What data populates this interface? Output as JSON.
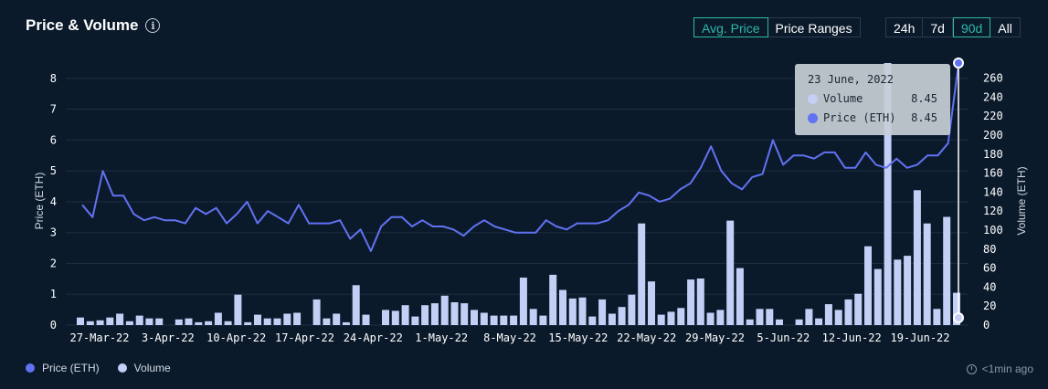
{
  "header": {
    "title": "Price & Volume",
    "info_icon": "info-icon"
  },
  "metric_tabs": [
    {
      "label": "Avg. Price",
      "active": true
    },
    {
      "label": "Price Ranges",
      "active": false
    }
  ],
  "range_tabs": [
    {
      "label": "24h",
      "active": false
    },
    {
      "label": "7d",
      "active": false
    },
    {
      "label": "90d",
      "active": true
    },
    {
      "label": "All",
      "active": false
    }
  ],
  "legend": [
    {
      "label": "Price (ETH)",
      "color": "#6272f2"
    },
    {
      "label": "Volume",
      "color": "#c3cff5"
    }
  ],
  "updated": {
    "icon": "history-clock-icon",
    "text": "<1min ago"
  },
  "tooltip": {
    "date": "23 June, 2022",
    "rows": [
      {
        "label": "Volume",
        "value": "8.45",
        "color": "#c3cff5"
      },
      {
        "label": "Price (ETH)",
        "value": "8.45",
        "color": "#6272f2"
      }
    ]
  },
  "chart_data": {
    "type": "bar+line",
    "ylabel_left": "Price (ETH)",
    "ylabel_right": "Volume (ETH)",
    "ylim_left": [
      0,
      8.5
    ],
    "ylim_right": [
      0,
      276
    ],
    "yticks_left": [
      0,
      1,
      2,
      3,
      4,
      5,
      6,
      7,
      8
    ],
    "yticks_right": [
      0,
      20,
      40,
      60,
      80,
      100,
      120,
      140,
      160,
      180,
      200,
      220,
      240,
      260
    ],
    "x_tick_labels": [
      "27-Mar-22",
      "3-Apr-22",
      "10-Apr-22",
      "17-Apr-22",
      "24-Apr-22",
      "1-May-22",
      "8-May-22",
      "15-May-22",
      "22-May-22",
      "29-May-22",
      "5-Jun-22",
      "12-Jun-22",
      "19-Jun-22"
    ],
    "grid": true,
    "legend_position": "bottom-left",
    "series": [
      {
        "name": "Price (ETH)",
        "type": "line",
        "axis": "left",
        "color": "#6272f2",
        "values": [
          3.9,
          3.5,
          5.0,
          4.2,
          4.2,
          3.6,
          3.4,
          3.5,
          3.4,
          3.4,
          3.3,
          3.8,
          3.6,
          3.8,
          3.3,
          3.6,
          4.0,
          3.3,
          3.7,
          3.5,
          3.3,
          3.9,
          3.3,
          3.3,
          3.3,
          3.4,
          2.8,
          3.1,
          2.4,
          3.2,
          3.5,
          3.5,
          3.2,
          3.4,
          3.2,
          3.2,
          3.1,
          2.9,
          3.2,
          3.4,
          3.2,
          3.1,
          3.0,
          3.0,
          3.0,
          3.4,
          3.2,
          3.1,
          3.3,
          3.3,
          3.3,
          3.4,
          3.7,
          3.9,
          4.3,
          4.2,
          4.0,
          4.1,
          4.4,
          4.6,
          5.1,
          5.8,
          5.0,
          4.6,
          4.4,
          4.8,
          4.9,
          6.0,
          5.2,
          5.5,
          5.5,
          5.4,
          5.6,
          5.6,
          5.1,
          5.1,
          5.6,
          5.2,
          5.1,
          5.4,
          5.1,
          5.2,
          5.5,
          5.5,
          5.9,
          8.45
        ]
      },
      {
        "name": "Volume",
        "type": "bar",
        "axis": "right",
        "color": "#c3cff5",
        "values": [
          8,
          4,
          5,
          8,
          12,
          4,
          10,
          7,
          7,
          0,
          6,
          7,
          3,
          4,
          13,
          4,
          32,
          3,
          11,
          7,
          7,
          12,
          13,
          0,
          27,
          7,
          12,
          3,
          42,
          11,
          0,
          16,
          15,
          21,
          9,
          21,
          23,
          31,
          24,
          23,
          16,
          13,
          10,
          10,
          10,
          50,
          17,
          10,
          53,
          37,
          28,
          29,
          9,
          27,
          12,
          19,
          32,
          107,
          46,
          11,
          14,
          18,
          48,
          49,
          13,
          16,
          110,
          60,
          6,
          17,
          17,
          6,
          0,
          6,
          17,
          7,
          22,
          16,
          27,
          33,
          83,
          59,
          276,
          69,
          73,
          142,
          107,
          17,
          114,
          34
        ]
      }
    ]
  }
}
